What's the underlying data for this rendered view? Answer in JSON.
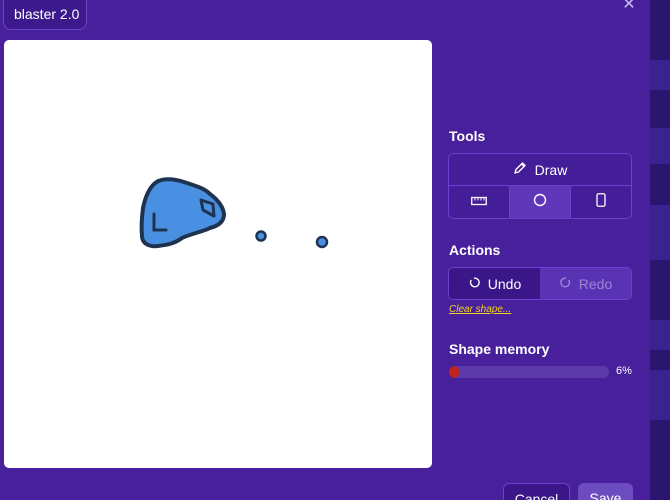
{
  "editor": {
    "name_value": "blaster 2.0"
  },
  "tools": {
    "title": "Tools",
    "draw_label": "Draw",
    "icons": [
      "ruler-icon",
      "circle-icon",
      "phone-icon"
    ],
    "active_tool": "circle"
  },
  "actions": {
    "title": "Actions",
    "undo_label": "Undo",
    "redo_label": "Redo",
    "clear_label": "Clear shape..."
  },
  "memory": {
    "title": "Shape memory",
    "percent_text": "6%",
    "fraction": 0.06
  },
  "footer": {
    "cancel_label": "Cancel",
    "save_label": "Save"
  },
  "colors": {
    "accent_purple": "#48209c",
    "shape_fill": "#4a90e2",
    "shape_stroke": "#1e3350",
    "link_yellow": "#f2d21b",
    "memory_red": "#c0241a"
  }
}
